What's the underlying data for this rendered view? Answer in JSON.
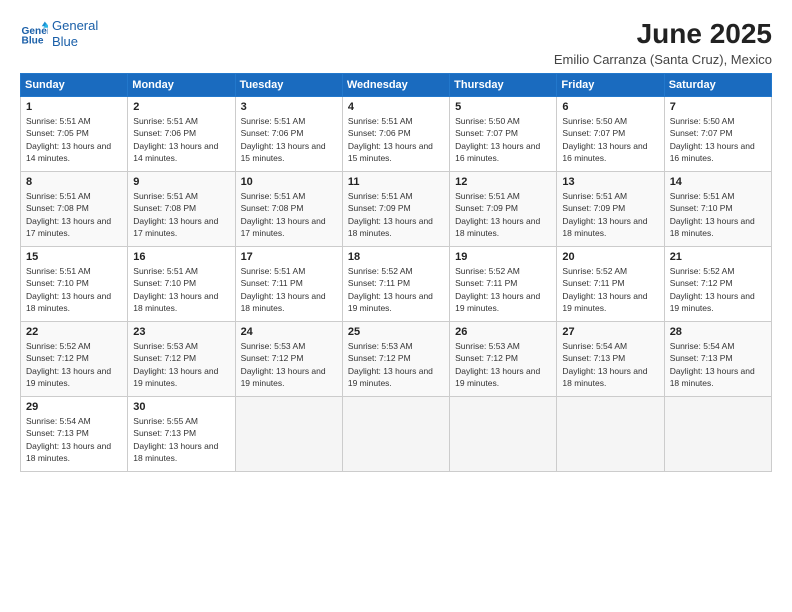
{
  "logo": {
    "line1": "General",
    "line2": "Blue"
  },
  "title": "June 2025",
  "subtitle": "Emilio Carranza (Santa Cruz), Mexico",
  "days_of_week": [
    "Sunday",
    "Monday",
    "Tuesday",
    "Wednesday",
    "Thursday",
    "Friday",
    "Saturday"
  ],
  "weeks": [
    [
      {
        "date": "1",
        "sunrise": "5:51 AM",
        "sunset": "7:05 PM",
        "daylight": "13 hours and 14 minutes."
      },
      {
        "date": "2",
        "sunrise": "5:51 AM",
        "sunset": "7:06 PM",
        "daylight": "13 hours and 14 minutes."
      },
      {
        "date": "3",
        "sunrise": "5:51 AM",
        "sunset": "7:06 PM",
        "daylight": "13 hours and 15 minutes."
      },
      {
        "date": "4",
        "sunrise": "5:51 AM",
        "sunset": "7:06 PM",
        "daylight": "13 hours and 15 minutes."
      },
      {
        "date": "5",
        "sunrise": "5:50 AM",
        "sunset": "7:07 PM",
        "daylight": "13 hours and 16 minutes."
      },
      {
        "date": "6",
        "sunrise": "5:50 AM",
        "sunset": "7:07 PM",
        "daylight": "13 hours and 16 minutes."
      },
      {
        "date": "7",
        "sunrise": "5:50 AM",
        "sunset": "7:07 PM",
        "daylight": "13 hours and 16 minutes."
      }
    ],
    [
      {
        "date": "8",
        "sunrise": "5:51 AM",
        "sunset": "7:08 PM",
        "daylight": "13 hours and 17 minutes."
      },
      {
        "date": "9",
        "sunrise": "5:51 AM",
        "sunset": "7:08 PM",
        "daylight": "13 hours and 17 minutes."
      },
      {
        "date": "10",
        "sunrise": "5:51 AM",
        "sunset": "7:08 PM",
        "daylight": "13 hours and 17 minutes."
      },
      {
        "date": "11",
        "sunrise": "5:51 AM",
        "sunset": "7:09 PM",
        "daylight": "13 hours and 18 minutes."
      },
      {
        "date": "12",
        "sunrise": "5:51 AM",
        "sunset": "7:09 PM",
        "daylight": "13 hours and 18 minutes."
      },
      {
        "date": "13",
        "sunrise": "5:51 AM",
        "sunset": "7:09 PM",
        "daylight": "13 hours and 18 minutes."
      },
      {
        "date": "14",
        "sunrise": "5:51 AM",
        "sunset": "7:10 PM",
        "daylight": "13 hours and 18 minutes."
      }
    ],
    [
      {
        "date": "15",
        "sunrise": "5:51 AM",
        "sunset": "7:10 PM",
        "daylight": "13 hours and 18 minutes."
      },
      {
        "date": "16",
        "sunrise": "5:51 AM",
        "sunset": "7:10 PM",
        "daylight": "13 hours and 18 minutes."
      },
      {
        "date": "17",
        "sunrise": "5:51 AM",
        "sunset": "7:11 PM",
        "daylight": "13 hours and 18 minutes."
      },
      {
        "date": "18",
        "sunrise": "5:52 AM",
        "sunset": "7:11 PM",
        "daylight": "13 hours and 19 minutes."
      },
      {
        "date": "19",
        "sunrise": "5:52 AM",
        "sunset": "7:11 PM",
        "daylight": "13 hours and 19 minutes."
      },
      {
        "date": "20",
        "sunrise": "5:52 AM",
        "sunset": "7:11 PM",
        "daylight": "13 hours and 19 minutes."
      },
      {
        "date": "21",
        "sunrise": "5:52 AM",
        "sunset": "7:12 PM",
        "daylight": "13 hours and 19 minutes."
      }
    ],
    [
      {
        "date": "22",
        "sunrise": "5:52 AM",
        "sunset": "7:12 PM",
        "daylight": "13 hours and 19 minutes."
      },
      {
        "date": "23",
        "sunrise": "5:53 AM",
        "sunset": "7:12 PM",
        "daylight": "13 hours and 19 minutes."
      },
      {
        "date": "24",
        "sunrise": "5:53 AM",
        "sunset": "7:12 PM",
        "daylight": "13 hours and 19 minutes."
      },
      {
        "date": "25",
        "sunrise": "5:53 AM",
        "sunset": "7:12 PM",
        "daylight": "13 hours and 19 minutes."
      },
      {
        "date": "26",
        "sunrise": "5:53 AM",
        "sunset": "7:12 PM",
        "daylight": "13 hours and 19 minutes."
      },
      {
        "date": "27",
        "sunrise": "5:54 AM",
        "sunset": "7:13 PM",
        "daylight": "13 hours and 18 minutes."
      },
      {
        "date": "28",
        "sunrise": "5:54 AM",
        "sunset": "7:13 PM",
        "daylight": "13 hours and 18 minutes."
      }
    ],
    [
      {
        "date": "29",
        "sunrise": "5:54 AM",
        "sunset": "7:13 PM",
        "daylight": "13 hours and 18 minutes."
      },
      {
        "date": "30",
        "sunrise": "5:55 AM",
        "sunset": "7:13 PM",
        "daylight": "13 hours and 18 minutes."
      },
      null,
      null,
      null,
      null,
      null
    ]
  ]
}
